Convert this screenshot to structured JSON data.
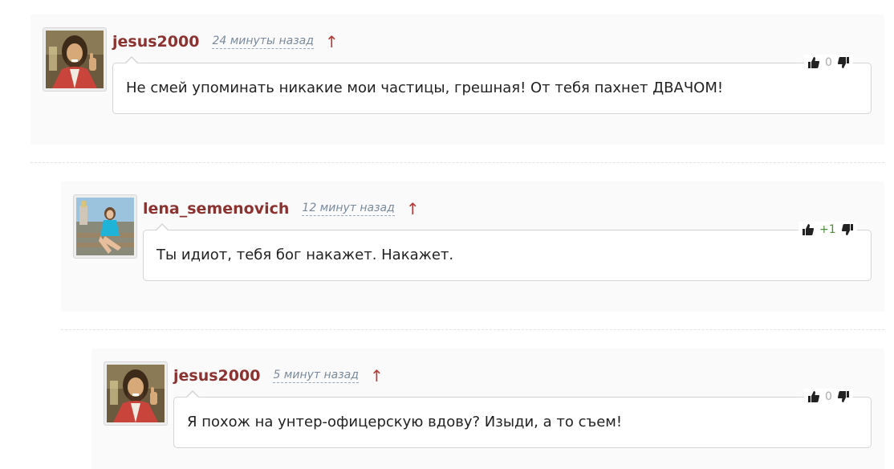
{
  "comments": [
    {
      "username": "jesus2000",
      "time": "24 минуты назад",
      "parent_arrow": "↑",
      "text": "Не смей упоминать никакие мои частицы, грешная! От тебя пахнет ДВАЧОМ!",
      "score": "0",
      "avatar": "jesus-avatar"
    },
    {
      "username": "lena_semenovich",
      "time": "12 минут назад",
      "parent_arrow": "↑",
      "text": "Ты идиот, тебя бог накажет. Накажет.",
      "score": "+1",
      "avatar": "lena-avatar"
    },
    {
      "username": "jesus2000",
      "time": "5 минут назад",
      "parent_arrow": "↑",
      "text": "Я похож на унтер-офицерскую вдову? Изыди, а то съем!",
      "score": "0",
      "avatar": "jesus-avatar"
    }
  ],
  "colors": {
    "username": "#8c3230",
    "timeago": "#7a8a9b",
    "arrow": "#b33a38",
    "positive_score": "#4d8c3a",
    "neutral_score": "#aaaaaa"
  },
  "icons": {
    "upvote": "thumbs-up-icon",
    "downvote": "thumbs-down-icon"
  }
}
